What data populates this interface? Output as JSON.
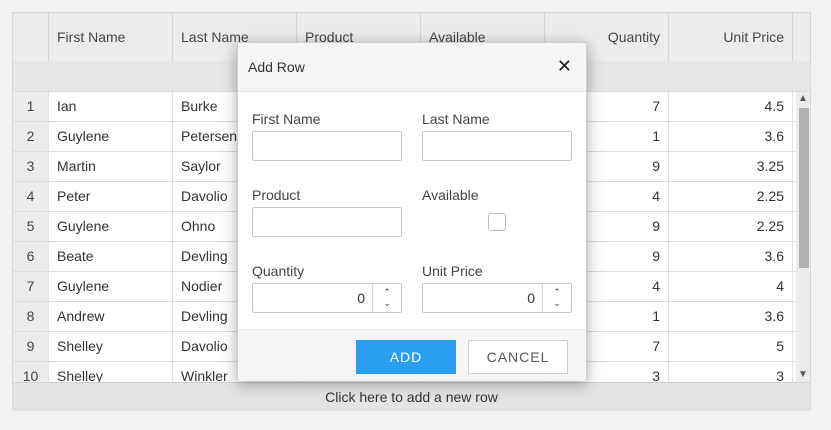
{
  "grid": {
    "columns": [
      "",
      "First Name",
      "Last Name",
      "Product",
      "Available",
      "Quantity",
      "Unit Price"
    ],
    "rows": [
      {
        "num": "1",
        "first": "Ian",
        "last": "Burke",
        "qty": "7",
        "price": "4.5"
      },
      {
        "num": "2",
        "first": "Guylene",
        "last": "Petersen",
        "qty": "1",
        "price": "3.6"
      },
      {
        "num": "3",
        "first": "Martin",
        "last": "Saylor",
        "qty": "9",
        "price": "3.25"
      },
      {
        "num": "4",
        "first": "Peter",
        "last": "Davolio",
        "qty": "4",
        "price": "2.25"
      },
      {
        "num": "5",
        "first": "Guylene",
        "last": "Ohno",
        "qty": "9",
        "price": "2.25"
      },
      {
        "num": "6",
        "first": "Beate",
        "last": "Devling",
        "qty": "9",
        "price": "3.6"
      },
      {
        "num": "7",
        "first": "Guylene",
        "last": "Nodier",
        "qty": "4",
        "price": "4"
      },
      {
        "num": "8",
        "first": "Andrew",
        "last": "Devling",
        "qty": "1",
        "price": "3.6"
      },
      {
        "num": "9",
        "first": "Shelley",
        "last": "Davolio",
        "qty": "7",
        "price": "5"
      },
      {
        "num": "10",
        "first": "Shelley",
        "last": "Winkler",
        "qty": "3",
        "price": "3"
      }
    ],
    "footer": "Click here to add a new row",
    "scroll_up_icon": "chevron-up-icon",
    "scroll_down_icon": "chevron-down-icon"
  },
  "dialog": {
    "title": "Add Row",
    "close_icon": "close-icon",
    "fields": {
      "first_name_label": "First Name",
      "first_name_value": "",
      "last_name_label": "Last Name",
      "last_name_value": "",
      "product_label": "Product",
      "product_value": "",
      "available_label": "Available",
      "available_checked": false,
      "quantity_label": "Quantity",
      "quantity_value": "0",
      "unit_price_label": "Unit Price",
      "unit_price_value": "0"
    },
    "add_label": "ADD",
    "cancel_label": "CANCEL"
  },
  "colors": {
    "accent": "#2a9ff0"
  }
}
